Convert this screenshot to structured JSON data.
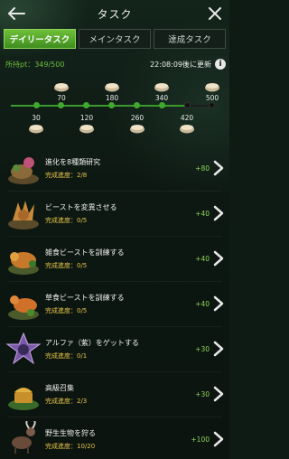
{
  "header": {
    "title": "タスク"
  },
  "tabs": [
    {
      "label": "デイリータスク",
      "active": true
    },
    {
      "label": "メインタスク",
      "active": false
    },
    {
      "label": "達成タスク",
      "active": false
    }
  ],
  "points": {
    "label": "所持pt：349/500",
    "reset_text": "22:08:09後に更新",
    "info": "i"
  },
  "milestones": {
    "top": [
      "70",
      "180",
      "340",
      "500"
    ],
    "bottom": [
      "30",
      "120",
      "260",
      "420"
    ]
  },
  "tasks": [
    {
      "name": "進化を8種類研究",
      "progress_label": "完成進度：",
      "progress": "2/8",
      "reward": "+80",
      "icon": "dna-beast-icon"
    },
    {
      "name": "ビーストを変異させる",
      "progress_label": "完成進度：",
      "progress": "0/5",
      "reward": "+40",
      "icon": "spiky-beast-icon"
    },
    {
      "name": "雑食ビーストを訓練する",
      "progress_label": "完成進度：",
      "progress": "0/5",
      "reward": "+40",
      "icon": "omnivore-beast-icon"
    },
    {
      "name": "草食ビーストを訓練する",
      "progress_label": "完成進度：",
      "progress": "0/5",
      "reward": "+40",
      "icon": "herbivore-beast-icon"
    },
    {
      "name": "アルファ（紫）をゲットする",
      "progress_label": "完成進度：",
      "progress": "0/1",
      "reward": "+30",
      "icon": "alpha-star-icon"
    },
    {
      "name": "高級召集",
      "progress_label": "完成進度：",
      "progress": "2/3",
      "reward": "+30",
      "icon": "summon-chest-icon"
    },
    {
      "name": "野生生物を狩る",
      "progress_label": "完成進度：",
      "progress": "10/20",
      "reward": "+100",
      "icon": "wild-goat-icon"
    }
  ]
}
